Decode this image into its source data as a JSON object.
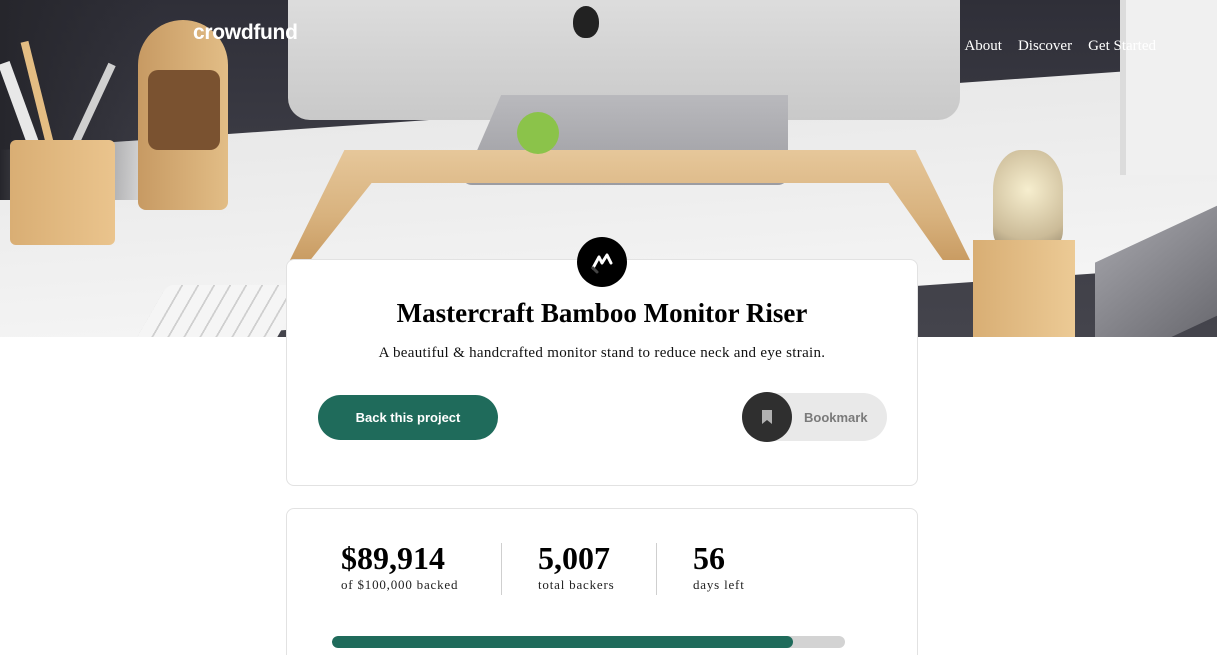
{
  "header": {
    "logo": "crowdfund",
    "nav": [
      "About",
      "Discover",
      "Get Started"
    ]
  },
  "project": {
    "logo_icon": "mastercraft-logo-icon",
    "title": "Mastercraft Bamboo Monitor Riser",
    "description": "A beautiful & handcrafted monitor stand to reduce neck and eye strain.",
    "back_button": "Back this project",
    "bookmark_button": "Bookmark",
    "bookmark_icon": "bookmark-icon"
  },
  "stats": {
    "backed_amount": "$89,914",
    "backed_label": "of $100,000 backed",
    "backers_count": "5,007",
    "backers_label": "total backers",
    "days_count": "56",
    "days_label": "days left",
    "progress_fraction": 0.899
  },
  "colors": {
    "accent": "#1f6b5b",
    "track": "#d3d3d3",
    "bookmark_bg": "#e9e9e9",
    "bookmark_icon_bg": "#2f2f2f"
  }
}
